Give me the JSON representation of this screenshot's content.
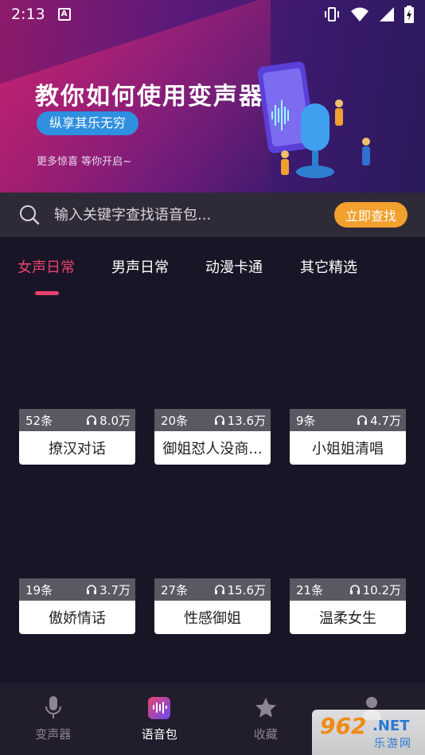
{
  "status_bar": {
    "time": "2:13"
  },
  "banner": {
    "title": "教你如何使用变声器",
    "pill": "纵享其乐无穷",
    "subtitle": "更多惊喜  等你开启~"
  },
  "search": {
    "placeholder": "输入关键字查找语音包...",
    "button": "立即查找"
  },
  "tabs": [
    {
      "label": "女声日常",
      "active": true
    },
    {
      "label": "男声日常",
      "active": false
    },
    {
      "label": "动漫卡通",
      "active": false
    },
    {
      "label": "其它精选",
      "active": false
    }
  ],
  "cards": [
    {
      "count": "52条",
      "plays": "8.0万",
      "title": "撩汉对话"
    },
    {
      "count": "20条",
      "plays": "13.6万",
      "title": "御姐怼人没商..."
    },
    {
      "count": "9条",
      "plays": "4.7万",
      "title": "小姐姐清唱"
    },
    {
      "count": "19条",
      "plays": "3.7万",
      "title": "傲娇情话"
    },
    {
      "count": "27条",
      "plays": "15.6万",
      "title": "性感御姐"
    },
    {
      "count": "21条",
      "plays": "10.2万",
      "title": "温柔女生"
    }
  ],
  "bottom_nav": [
    {
      "label": "变声器",
      "icon": "microphone-icon",
      "active": false
    },
    {
      "label": "语音包",
      "icon": "voice-pack-icon",
      "active": true
    },
    {
      "label": "收藏",
      "icon": "star-icon",
      "active": false
    },
    {
      "label": "",
      "icon": "person-icon",
      "active": false
    }
  ],
  "watermark": {
    "number": "962",
    "domain": ".NET",
    "text": "乐游网"
  },
  "colors": {
    "accent": "#e8436e",
    "search_button": "#f2a02e",
    "pill": "#2f8fe0",
    "background": "#1a1526"
  }
}
